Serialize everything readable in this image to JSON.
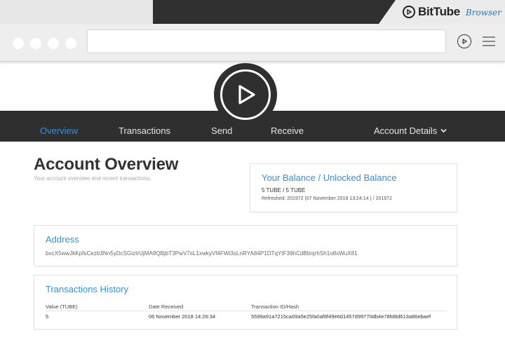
{
  "browser": {
    "brand_name": "BitTube",
    "brand_sub": "Browser",
    "url": ""
  },
  "nav": {
    "items": [
      {
        "label": "Overview",
        "active": true
      },
      {
        "label": "Transactions",
        "active": false
      },
      {
        "label": "Send",
        "active": false
      },
      {
        "label": "Receive",
        "active": false
      },
      {
        "label": "Account Details",
        "active": false
      }
    ]
  },
  "page": {
    "title": "Account Overview",
    "subtitle": "Your account overview and recent transactions."
  },
  "balance": {
    "title": "Your Balance / Unlocked Balance",
    "value": "5 TUBE / 5 TUBE",
    "refreshed": "Refreshed: 201972 (07 November 2018 13:24:14 ) / 201972"
  },
  "address": {
    "title": "Address",
    "value": "bxcX5wwJkKpfsCezb3Nn5yDcSGiztrUjMA9QBjbT3PwV7sL1xwkyVf4FWi3sLnRYA84P1DTqYtF39hCdBbnjrhSh1o8xWuX81"
  },
  "transactions": {
    "title": "Transactions History",
    "headers": [
      "Value (TUBE)",
      "Date Received",
      "Transaction ID/Hash"
    ],
    "rows": [
      {
        "value": "5",
        "date": "06 November 2018 14:26:34",
        "hash": "5599a91a7215ca69a5e25fa0af8f49e6d1457d99770db4e78fd8d613a86ebaef"
      }
    ]
  },
  "colors": {
    "accent": "#3a8fd6",
    "dark": "#2f2f2f"
  }
}
